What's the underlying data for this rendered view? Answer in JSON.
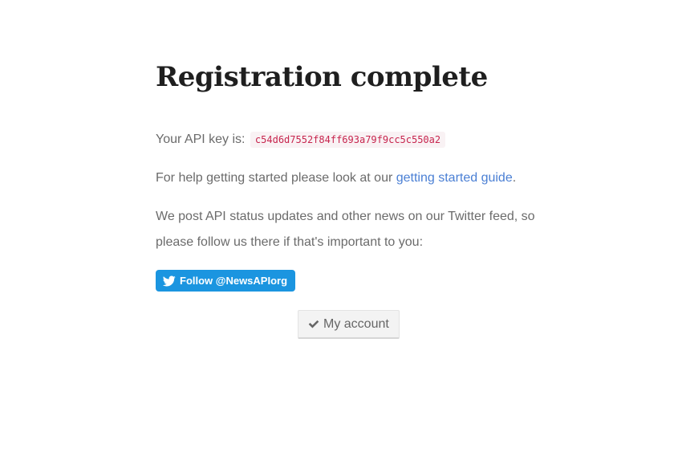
{
  "page": {
    "title": "Registration complete"
  },
  "api_key": {
    "label": "Your API key is: ",
    "value": "c54d6d7552f84ff693a79f9cc5c550a2"
  },
  "help": {
    "prefix": "For help getting started please look at our ",
    "link_text": "getting started guide",
    "suffix": "."
  },
  "news": {
    "text": "We post API status updates and other news on our Twitter feed, so please follow us there if that's important to you:"
  },
  "twitter_button": {
    "label": "Follow @NewsAPIorg",
    "icon": "twitter-bird-icon",
    "color": "#1b95e0"
  },
  "account_button": {
    "label": "My account",
    "icon": "check-icon"
  },
  "colors": {
    "link": "#4a7fd4",
    "code": "#c7254e",
    "text": "#6b6b6b",
    "title": "#1f1f1f"
  }
}
